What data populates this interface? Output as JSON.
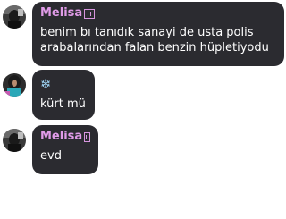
{
  "colors": {
    "bubble_bg": "#2b2b30",
    "sender_color": "#e09be8",
    "text_color": "#ffffff",
    "snow_color": "#9fd6f7"
  },
  "messages": [
    {
      "sender": "Melisa",
      "lines": [
        "benim bı tanıdık sanayi de usta polis",
        "arabalarından falan benzin hüpletiyodu"
      ]
    },
    {
      "sender_icon": "snowflake-icon",
      "sender_glyph": "❄",
      "lines": [
        "kürt mü"
      ]
    },
    {
      "sender": "Melisa",
      "lines": [
        "evd"
      ]
    }
  ]
}
